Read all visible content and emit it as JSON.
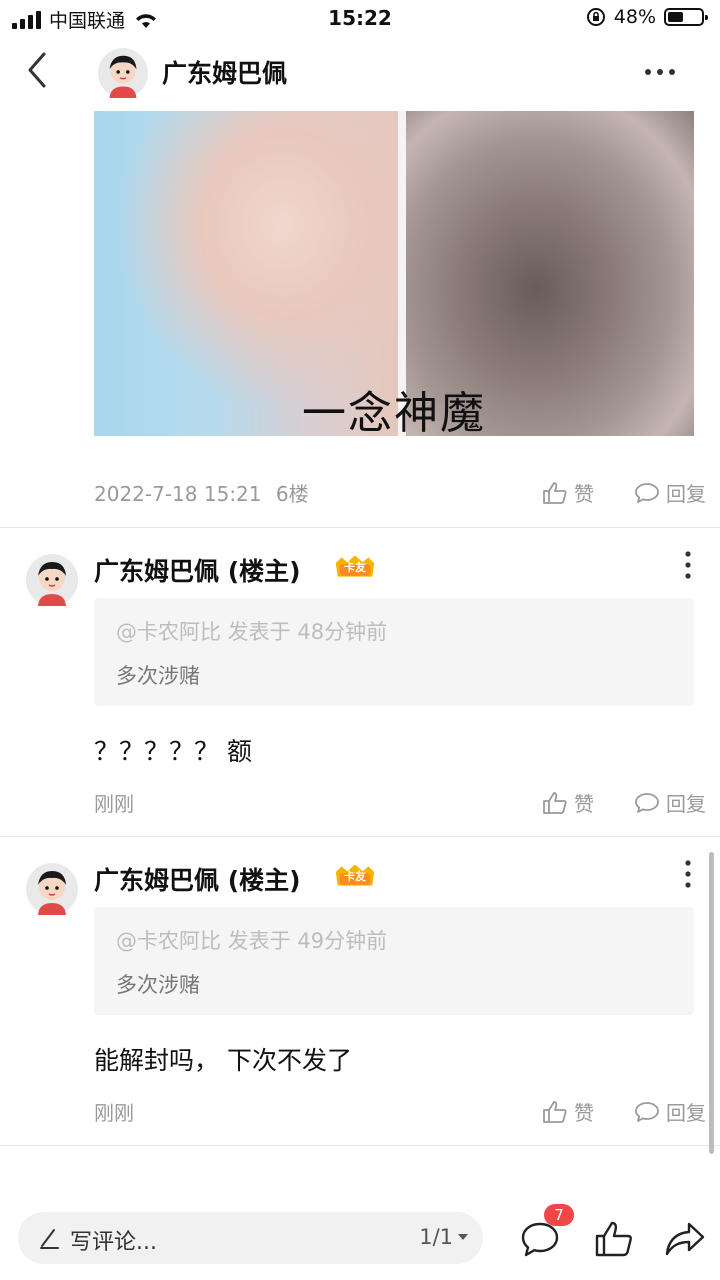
{
  "status_bar": {
    "carrier": "中国联通",
    "time": "15:22",
    "battery": "48%",
    "battery_level": 0.48
  },
  "nav": {
    "title": "广东姆巴佩"
  },
  "post": {
    "image_caption": "一念神魔",
    "timestamp": "2022-7-18 15:21",
    "floor": "6楼",
    "like_label": "赞",
    "reply_label": "回复"
  },
  "comments": [
    {
      "author": "广东姆巴佩 (楼主)",
      "badge": "卡友",
      "quote_source": "@卡农阿比 发表于 48分钟前",
      "quote_text": "多次涉赌",
      "body": "？？？？？ 额",
      "time": "刚刚",
      "like_label": "赞",
      "reply_label": "回复"
    },
    {
      "author": "广东姆巴佩 (楼主)",
      "badge": "卡友",
      "quote_source": "@卡农阿比 发表于 49分钟前",
      "quote_text": "多次涉赌",
      "body": "能解封吗， 下次不发了",
      "time": "刚刚",
      "like_label": "赞",
      "reply_label": "回复"
    }
  ],
  "bottom_bar": {
    "placeholder": "写评论...",
    "page_indicator": "1/1",
    "comment_count": "7"
  },
  "colors": {
    "badge_red": "#f04646",
    "badge_gold": "#f5b400",
    "muted_text": "#9a9a9a"
  }
}
